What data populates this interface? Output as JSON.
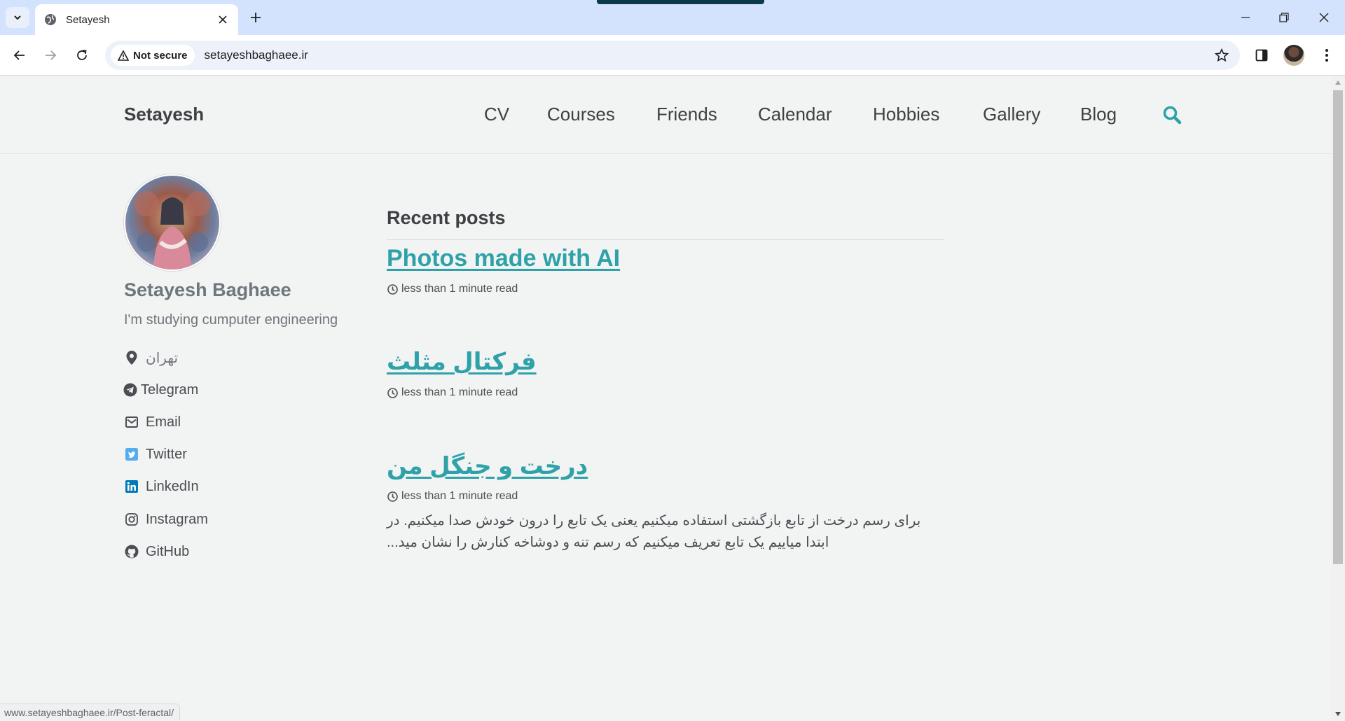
{
  "browser": {
    "tab": {
      "title": "Setayesh"
    },
    "security_label": "Not secure",
    "url": "setayeshbaghaee.ir",
    "status_url": "www.setayeshbaghaee.ir/Post-feractal/"
  },
  "masthead": {
    "site_title": "Setayesh",
    "nav": [
      "CV",
      "Courses",
      "Friends",
      "Calendar",
      "Hobbies",
      "Gallery",
      "Blog"
    ]
  },
  "author": {
    "name": "Setayesh Baghaee",
    "bio": "I'm studying cumputer engineering",
    "links": [
      {
        "label": "تهران",
        "icon": "map-marker-icon"
      },
      {
        "label": "Telegram",
        "icon": "telegram-icon"
      },
      {
        "label": "Email",
        "icon": "envelope-icon"
      },
      {
        "label": "Twitter",
        "icon": "twitter-icon"
      },
      {
        "label": "LinkedIn",
        "icon": "linkedin-icon"
      },
      {
        "label": "Instagram",
        "icon": "instagram-icon"
      },
      {
        "label": "GitHub",
        "icon": "github-icon"
      }
    ]
  },
  "main": {
    "heading": "Recent posts",
    "posts": [
      {
        "title": "Photos made with AI",
        "meta": "less than 1 minute read"
      },
      {
        "title": "فرکتال مثلث",
        "meta": "less than 1 minute read"
      },
      {
        "title": "درخت و جنگل من",
        "meta": "less than 1 minute read",
        "excerpt": "برای رسم درخت از تابع بازگشتی استفاده میکنیم یعنی یک تابع را درون خودش صدا میکنیم. در ابتدا میاییم یک تابع تعریف میکنیم که رسم تنه و دوشاخه کنارش را نشان مید..."
      }
    ]
  },
  "colors": {
    "accent": "#2ea2a8",
    "text": "#3d4144",
    "muted": "#6f777d",
    "background": "#f2f3f3"
  }
}
